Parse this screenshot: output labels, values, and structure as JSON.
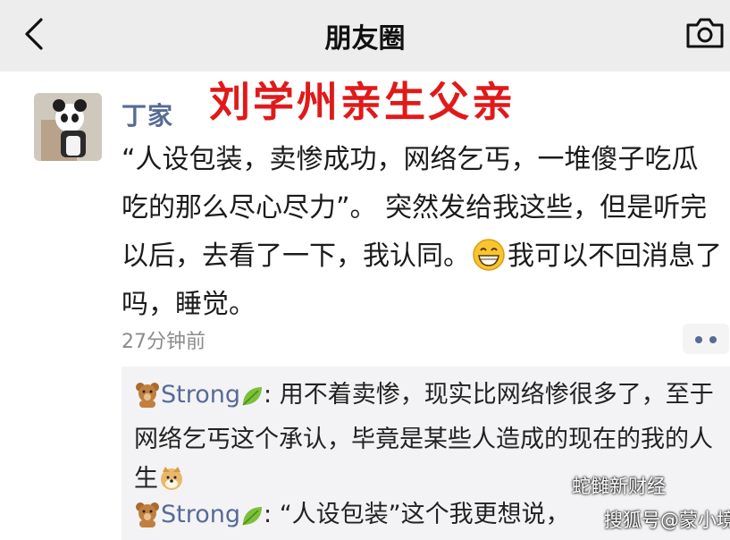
{
  "header": {
    "title": "朋友圈",
    "back_icon": "chevron-left-icon",
    "camera_icon": "camera-icon",
    "background": "#ededed"
  },
  "overlay_banner": {
    "text": "刘学州亲生父亲",
    "color": "#e01a1a"
  },
  "post": {
    "author": "丁家",
    "author_color": "#576b95",
    "text_part1": "“人设包装，卖惨成功，网络乞丐，一堆傻子吃瓜吃的那么尽心尽力”。 突然发给我这些，但是听完以后，去看了一下，我认同。",
    "text_part2": "我可以不回消息了吗，睡觉。",
    "emoji_icon": "grinning-face-emoji-icon",
    "timestamp": "27分钟前"
  },
  "comments": [
    {
      "name": "Strong",
      "name_icon_left": "teddy-bear-emoji-icon",
      "name_icon_right": "leaf-emoji-icon",
      "text": ": 用不着卖惨，现实比网络惨很多了，至于网络乞丐这个承认，毕竟是某些人造成的现在的我的人生",
      "trailing_icon": "doge-emoji-icon"
    },
    {
      "name": "Strong",
      "name_icon_left": "teddy-bear-emoji-icon",
      "name_icon_right": "leaf-emoji-icon",
      "text": ": “人设包装”这个我更想说，"
    }
  ],
  "watermarks": {
    "line1": "蛇雠新财经",
    "line2": "搜狐号@蒙小境"
  }
}
